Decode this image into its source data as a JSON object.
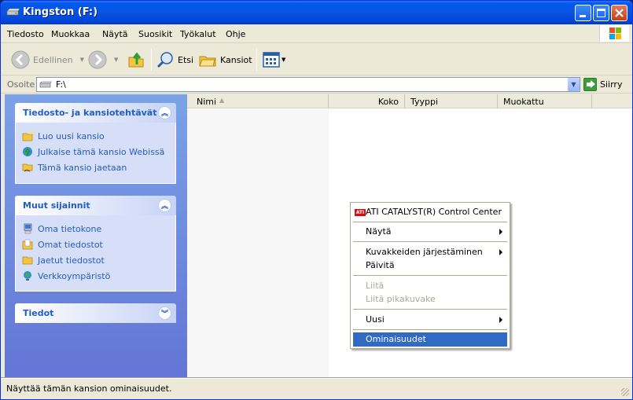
{
  "window": {
    "title": "Kingston (F:)"
  },
  "menubar": {
    "items": [
      "Tiedosto",
      "Muokkaa",
      "Näytä",
      "Suosikit",
      "Työkalut",
      "Ohje"
    ]
  },
  "toolbar": {
    "back_label": "Edellinen",
    "search_label": "Etsi",
    "folders_label": "Kansiot"
  },
  "address": {
    "label": "Osoite",
    "value": "F:\\",
    "go_label": "Siirry"
  },
  "tasks": {
    "title": "Tiedosto- ja kansiotehtävät",
    "items": [
      "Luo uusi kansio",
      "Julkaise tämä kansio Webissä",
      "Tämä kansio jaetaan"
    ]
  },
  "places": {
    "title": "Muut sijainnit",
    "items": [
      "Oma tietokone",
      "Omat tiedostot",
      "Jaetut tiedostot",
      "Verkkoympäristö"
    ]
  },
  "details": {
    "title": "Tiedot"
  },
  "columns": {
    "name": "Nimi",
    "size": "Koko",
    "type": "Tyyppi",
    "modified": "Muokattu"
  },
  "context_menu": {
    "ati": "ATI CATALYST(R) Control Center",
    "view": "Näytä",
    "arrange": "Kuvakkeiden järjestäminen",
    "refresh": "Päivitä",
    "paste": "Liitä",
    "paste_shortcut": "Liitä pikakuvake",
    "new": "Uusi",
    "properties": "Ominaisuudet"
  },
  "status": {
    "text": "Näyttää tämän kansion ominaisuudet."
  },
  "colors": {
    "title_bar": "#0058ee",
    "task_pane": "#7ba2e7",
    "highlight": "#316ac5",
    "link": "#215dc6"
  }
}
